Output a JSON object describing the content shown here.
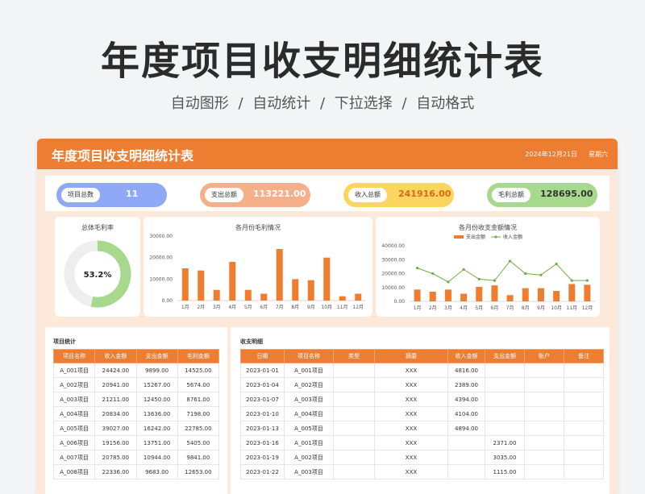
{
  "hero": {
    "title": "年度项目收支明细统计表",
    "subtitle": "自动图形 / 自动统计 / 下拉选择   / 自动格式"
  },
  "header": {
    "title": "年度项目收支明细统计表",
    "date": "2024年12月21日",
    "weekday": "星期六"
  },
  "kpis": [
    {
      "label": "项目总数",
      "value": "11",
      "color": "#8fa9f7"
    },
    {
      "label": "支出总额",
      "value": "113221.00",
      "color": "#f5b08a"
    },
    {
      "label": "收入总额",
      "value": "241916.00",
      "color": "#fcd55f"
    },
    {
      "label": "毛利总额",
      "value": "128695.00",
      "color": "#a7d98d"
    }
  ],
  "donut": {
    "title": "总体毛利率",
    "value_text": "53.2%",
    "fraction": 0.532,
    "color": "#a7d98d"
  },
  "chart_data": [
    {
      "type": "bar",
      "title": "各月份毛利情况",
      "categories": [
        "1月",
        "2月",
        "3月",
        "4月",
        "5月",
        "6月",
        "7月",
        "8月",
        "9月",
        "10月",
        "11月",
        "12月"
      ],
      "values": [
        15000,
        14000,
        5000,
        18000,
        5000,
        3200,
        24000,
        10000,
        9500,
        20000,
        2000,
        3200
      ],
      "ylim": [
        0,
        30000
      ],
      "yticks": [
        "0.00",
        "10000.00",
        "20000.00",
        "30000.00"
      ],
      "color": "#ed7d31"
    },
    {
      "type": "bar+line",
      "title": "各月份收支金额情况",
      "categories": [
        "1月",
        "2月",
        "3月",
        "4月",
        "5月",
        "6月",
        "7月",
        "8月",
        "9月",
        "10月",
        "11月",
        "12月"
      ],
      "series": [
        {
          "name": "支出金额",
          "type": "bar",
          "values": [
            8500,
            7000,
            8500,
            5500,
            10500,
            11500,
            4500,
            9500,
            9500,
            7500,
            12500,
            12000
          ],
          "color": "#ed7d31"
        },
        {
          "name": "收入金额",
          "type": "line",
          "values": [
            24000,
            20000,
            14000,
            23000,
            16000,
            15000,
            29000,
            20000,
            19000,
            27000,
            15000,
            15000
          ],
          "color": "#70ad47"
        }
      ],
      "ylim": [
        0,
        40000
      ],
      "yticks": [
        "0.00",
        "10000.00",
        "20000.00",
        "30000.00",
        "40000.00"
      ],
      "legend": "top"
    }
  ],
  "project_stats": {
    "title": "项目统计",
    "headers": [
      "项目名称",
      "收入金额",
      "支出金额",
      "毛利金额"
    ],
    "rows": [
      [
        "A_001项目",
        "24424.00",
        "9899.00",
        "14525.00"
      ],
      [
        "A_002项目",
        "20941.00",
        "15267.00",
        "5674.00"
      ],
      [
        "A_003项目",
        "21211.00",
        "12450.00",
        "8761.00"
      ],
      [
        "A_004项目",
        "20834.00",
        "13636.00",
        "7198.00"
      ],
      [
        "A_005项目",
        "39027.00",
        "16242.00",
        "22785.00"
      ],
      [
        "A_006项目",
        "19156.00",
        "13751.00",
        "5405.00"
      ],
      [
        "A_007项目",
        "20785.00",
        "10944.00",
        "9841.00"
      ],
      [
        "A_008项目",
        "22336.00",
        "9683.00",
        "12653.00"
      ]
    ]
  },
  "details": {
    "title": "收支明细",
    "headers": [
      "日期",
      "项目名称",
      "类型",
      "摘要",
      "收入金额",
      "支出金额",
      "账户",
      "备注"
    ],
    "rows": [
      [
        "2023-01-01",
        "A_001项目",
        "",
        "XXX",
        "4816.00",
        "",
        "",
        ""
      ],
      [
        "2023-01-04",
        "A_002项目",
        "",
        "XXX",
        "2389.00",
        "",
        "",
        ""
      ],
      [
        "2023-01-07",
        "A_003项目",
        "",
        "XXX",
        "4394.00",
        "",
        "",
        ""
      ],
      [
        "2023-01-10",
        "A_004项目",
        "",
        "XXX",
        "4104.00",
        "",
        "",
        ""
      ],
      [
        "2023-01-13",
        "A_005项目",
        "",
        "XXX",
        "4894.00",
        "",
        "",
        ""
      ],
      [
        "2023-01-16",
        "A_001项目",
        "",
        "XXX",
        "",
        "2371.00",
        "",
        ""
      ],
      [
        "2023-01-19",
        "A_002项目",
        "",
        "XXX",
        "",
        "3035.00",
        "",
        ""
      ],
      [
        "2023-01-22",
        "A_003项目",
        "",
        "XXX",
        "",
        "1115.00",
        "",
        ""
      ]
    ]
  }
}
